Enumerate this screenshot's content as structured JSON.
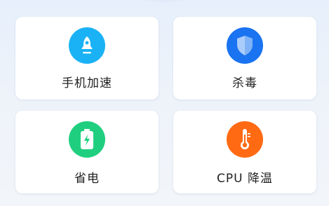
{
  "cards": [
    {
      "label": "手机加速",
      "icon": "rocket-icon",
      "color": "#1ab2f5"
    },
    {
      "label": "杀毒",
      "icon": "shield-icon",
      "color": "#1a73f0"
    },
    {
      "label": "省电",
      "icon": "battery-icon",
      "color": "#1fcf7f"
    },
    {
      "label": "CPU 降温",
      "icon": "thermometer-icon",
      "color": "#ff6a13"
    }
  ]
}
